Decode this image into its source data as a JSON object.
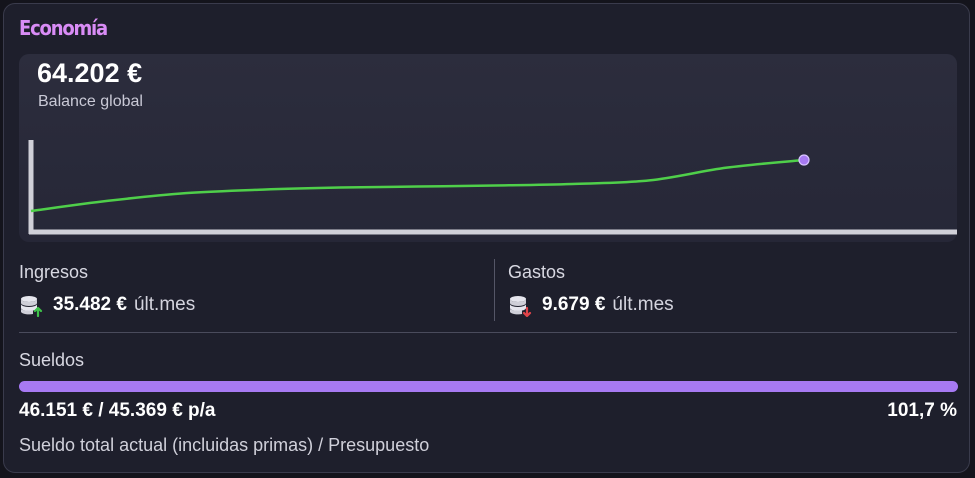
{
  "card": {
    "title": "Economía"
  },
  "balance": {
    "value": "64.202 €",
    "label": "Balance global"
  },
  "chart_data": {
    "type": "line",
    "series": [
      {
        "values": [
          0.0,
          0.2,
          0.35,
          0.42,
          0.46,
          0.48,
          0.5,
          0.53,
          0.6,
          0.85,
          1.0
        ]
      }
    ],
    "line_color": "#4fcf4a",
    "end_point_color": "#a77af2",
    "axis_color": "#d0d0d8",
    "grid": false
  },
  "ingresos": {
    "label": "Ingresos",
    "value": "35.482 €",
    "suffix": "últ.mes",
    "icon": "coins-up-icon",
    "arrow_color": "#3ec24a"
  },
  "gastos": {
    "label": "Gastos",
    "value": "9.679 €",
    "suffix": "últ.mes",
    "icon": "coins-down-icon",
    "arrow_color": "#e0444a"
  },
  "sueldos": {
    "label": "Sueldos",
    "values": "46.151 € / 45.369 € p/a",
    "percent_text": "101,7 %",
    "progress": 1.0,
    "caption": "Sueldo total actual (incluidas primas) / Presupuesto"
  },
  "colors": {
    "title": "#d98cf6",
    "progress": "#a77af2"
  }
}
